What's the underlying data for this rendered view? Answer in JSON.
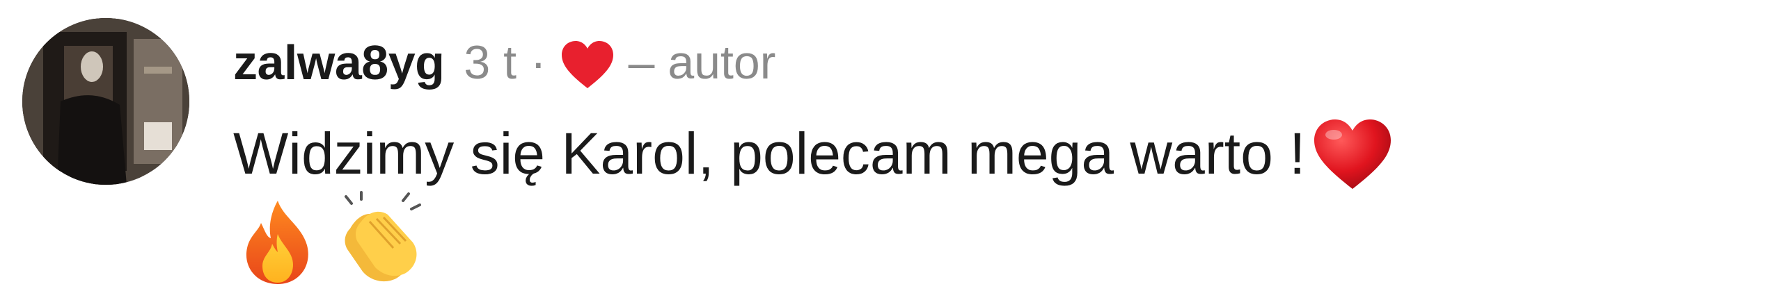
{
  "comment": {
    "username": "zalwa8yg",
    "time": "3 t",
    "separator": "·",
    "liked_icon": "heart-icon",
    "author_label": "– autor",
    "text": "Widzimy się Karol, polecam mega warto !",
    "trailing_emojis": [
      "red-heart-emoji",
      "fire-emoji",
      "clapping-hands-emoji"
    ]
  },
  "colors": {
    "username": "#1a1a1a",
    "meta": "#8a8a8a",
    "heart": "#e8202e",
    "text": "#1a1a1a"
  }
}
